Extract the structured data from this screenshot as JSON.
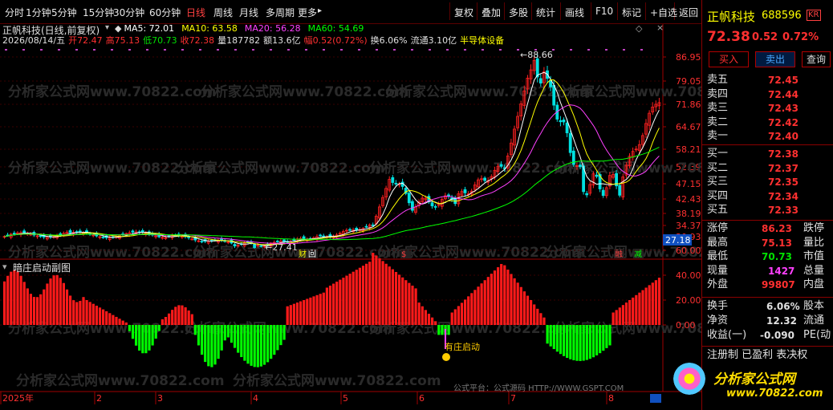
{
  "toolbar": {
    "left": [
      "分时",
      "1分钟",
      "5分钟",
      "15分钟",
      "30分钟",
      "60分钟",
      "日线",
      "周线",
      "月线",
      "多周期",
      "更多"
    ],
    "active": "日线",
    "more_arrow": "▸",
    "right": [
      "复权",
      "叠加",
      "多股",
      "统计",
      "画线",
      "F10",
      "标记",
      "+自选",
      "返回"
    ]
  },
  "chart": {
    "title": "正帆科技(日线,前复权)",
    "ma": [
      {
        "label": "MA5: 72.01",
        "color": "#ffffff"
      },
      {
        "label": "MA10: 63.58",
        "color": "#ffff00"
      },
      {
        "label": "MA20: 56.28",
        "color": "#ff40ff"
      },
      {
        "label": "MA60: 54.69",
        "color": "#00ff00"
      }
    ],
    "info": {
      "date": "2026/08/14/五",
      "open": "开72.47",
      "high": "高75.13",
      "low": "低70.73",
      "close": "收72.38",
      "vol": "量187782",
      "amt": "额13.6亿",
      "amp": "幅0.52(0.72%)",
      "turn": "换6.06%",
      "float": "流通3.10亿",
      "sector": "半导体设备"
    },
    "price_axis": [
      "86.95",
      "79.05",
      "71.86",
      "64.67",
      "58.21",
      "52.39",
      "47.15",
      "42.43",
      "38.19",
      "34.37",
      "30.93"
    ],
    "cur_price": "27.18",
    "max_label": "88.66",
    "min_label": "27.41",
    "marks": [
      "财",
      "回",
      "$",
      "融",
      "减"
    ],
    "sub_title": "暗庄启动副图",
    "sub_axis": [
      "60.00",
      "40.00",
      "20.00",
      "0.00"
    ],
    "signal": "有庄启动",
    "date_axis": [
      "2025年",
      "2",
      "3",
      "4",
      "5",
      "6",
      "7",
      "8"
    ],
    "watermark": "分析家公式网www.70822.com",
    "footer": "公式平台：公式源码 HTTP://WWW.GSPT.COM"
  },
  "quote": {
    "name": "正帆科技",
    "code": "688596",
    "tag": "KR",
    "price": "72.38",
    "change": "0.52",
    "pct": "0.72%",
    "buttons": [
      "买入",
      "卖出",
      "查询"
    ],
    "sell": [
      {
        "label": "卖五",
        "price": "72.45"
      },
      {
        "label": "卖四",
        "price": "72.44"
      },
      {
        "label": "卖三",
        "price": "72.43"
      },
      {
        "label": "卖二",
        "price": "72.42"
      },
      {
        "label": "卖一",
        "price": "72.40"
      }
    ],
    "buy": [
      {
        "label": "买一",
        "price": "72.38"
      },
      {
        "label": "买二",
        "price": "72.37"
      },
      {
        "label": "买三",
        "price": "72.35"
      },
      {
        "label": "买四",
        "price": "72.34"
      },
      {
        "label": "买五",
        "price": "72.33"
      }
    ],
    "stats": [
      {
        "l": "涨停",
        "v": "86.23",
        "l2": "跌停",
        "c": "#ff3030"
      },
      {
        "l": "最高",
        "v": "75.13",
        "l2": "量比",
        "c": "#ff3030"
      },
      {
        "l": "最低",
        "v": "70.73",
        "l2": "市值",
        "c": "#00e000"
      },
      {
        "l": "现量",
        "v": "1427",
        "l2": "总量",
        "c": "#ff40ff"
      },
      {
        "l": "外盘",
        "v": "99807",
        "l2": "内盘",
        "c": "#ff3030"
      }
    ],
    "stats2": [
      {
        "l": "换手",
        "v": "6.06%",
        "l2": "股本"
      },
      {
        "l": "净资",
        "v": "12.32",
        "l2": "流通"
      },
      {
        "l": "收益(一)",
        "v": "-0.090",
        "l2": "PE(动"
      }
    ],
    "tags": "注册制 已盈利 表决权",
    "brand": "分析家公式网",
    "brand_url": "www.70822.com"
  },
  "colors": {
    "up": "#ff2020",
    "down": "#00e0e0",
    "sub_up": "#ff1a1a",
    "sub_down": "#00ff00",
    "axis": "#a00000"
  }
}
